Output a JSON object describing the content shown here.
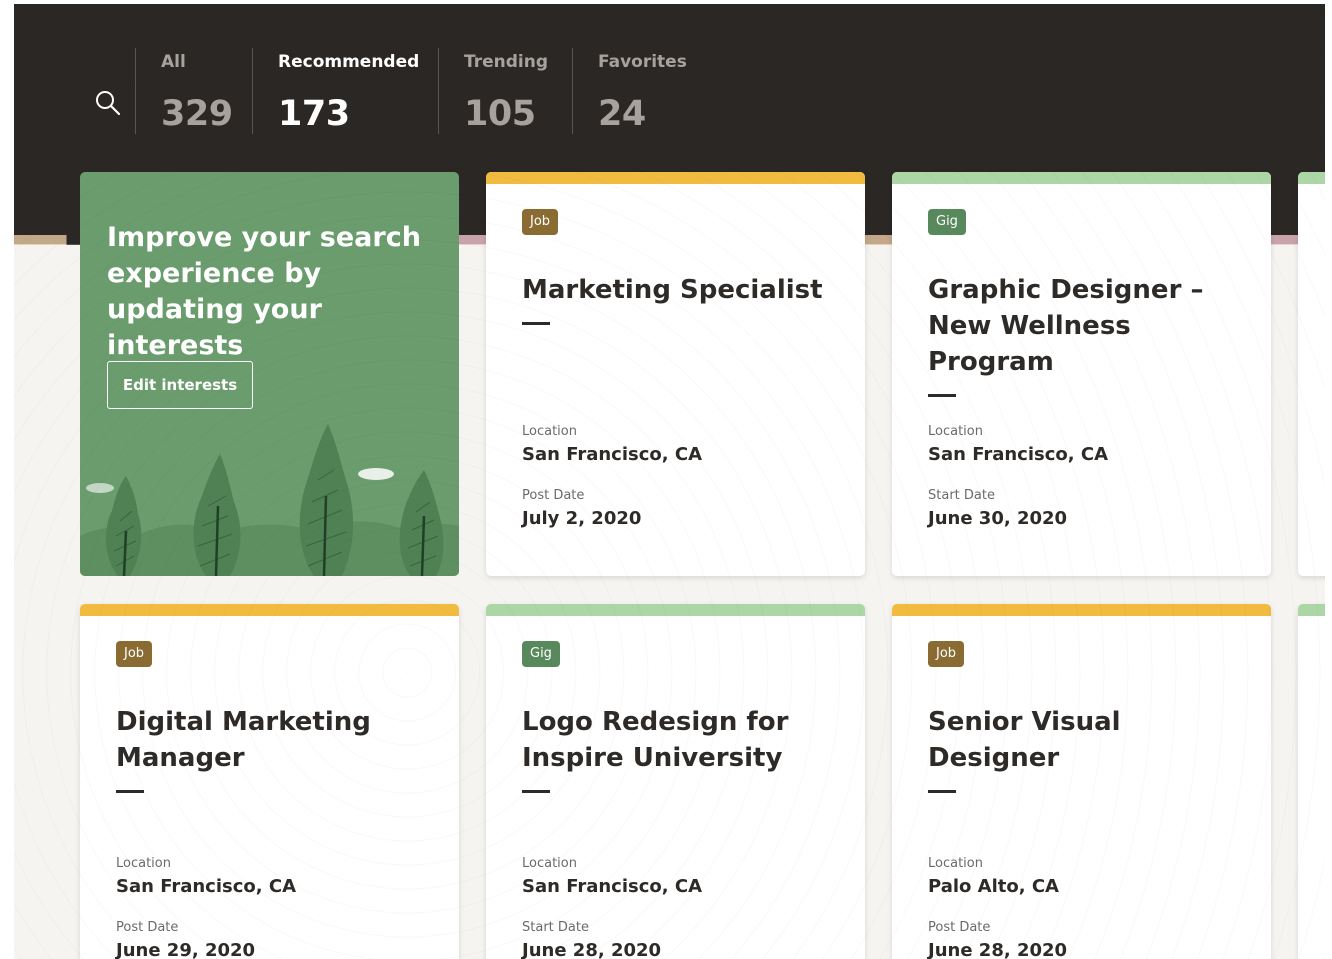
{
  "colors": {
    "header_bg": "#2b2724",
    "job_accent": "#f0bb3f",
    "gig_accent": "#acd6a5",
    "job_tag": "#8a6c33",
    "gig_tag": "#57895c",
    "promo_bg": "#6a9c6d"
  },
  "header": {
    "search_icon": "search-icon",
    "filters": [
      {
        "label": "All",
        "count": "329",
        "active": false
      },
      {
        "label": "Recommended",
        "count": "173",
        "active": true
      },
      {
        "label": "Trending",
        "count": "105",
        "active": false
      },
      {
        "label": "Favorites",
        "count": "24",
        "active": false
      }
    ]
  },
  "promo": {
    "text": "Improve your search experience by updating your interests",
    "button_label": "Edit interests"
  },
  "cards": [
    {
      "type": "Job",
      "title": "Marketing Specialist",
      "field1_label": "Location",
      "field1_value": "San Francisco, CA",
      "field2_label": "Post Date",
      "field2_value": "July 2, 2020"
    },
    {
      "type": "Gig",
      "title": "Graphic Designer – New Wellness Program",
      "field1_label": "Location",
      "field1_value": "San Francisco, CA",
      "field2_label": "Start Date",
      "field2_value": "June 30, 2020"
    },
    {
      "type": "Job",
      "title": "Digital Marketing Manager",
      "field1_label": "Location",
      "field1_value": "San Francisco, CA",
      "field2_label": "Post Date",
      "field2_value": "June 29, 2020"
    },
    {
      "type": "Gig",
      "title": "Logo Redesign for Inspire University",
      "field1_label": "Location",
      "field1_value": "San Francisco, CA",
      "field2_label": "Start Date",
      "field2_value": "June 28, 2020"
    },
    {
      "type": "Job",
      "title": "Senior Visual Designer",
      "field1_label": "Location",
      "field1_value": "Palo Alto, CA",
      "field2_label": "Post Date",
      "field2_value": "June 28, 2020"
    }
  ]
}
